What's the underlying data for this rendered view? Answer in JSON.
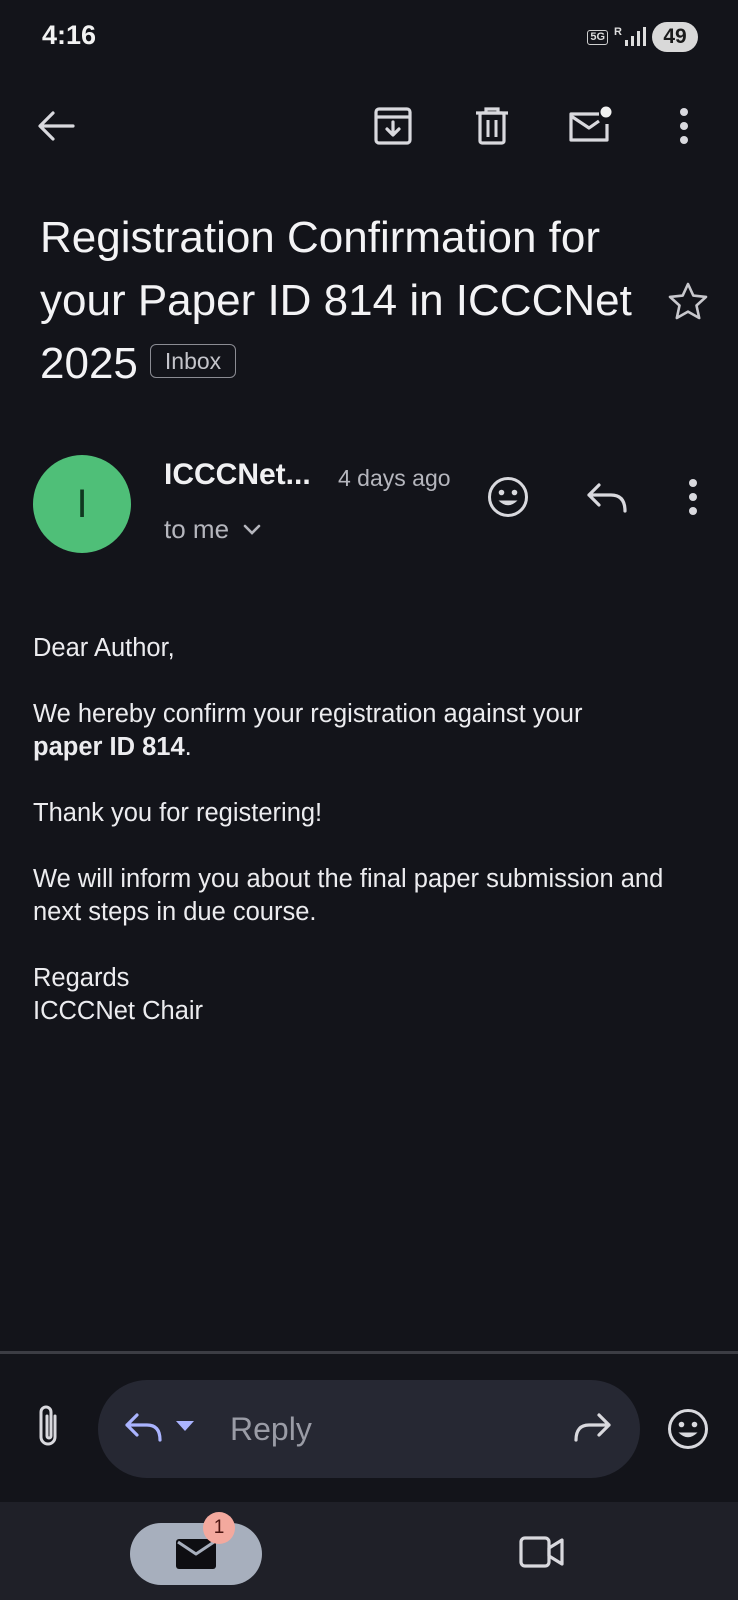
{
  "status_bar": {
    "time": "4:16",
    "network": "5G",
    "signal": "R",
    "battery": "49"
  },
  "toolbar": {
    "icons": [
      "back-arrow-icon",
      "archive-icon",
      "delete-icon",
      "mark-unread-icon",
      "more-vert-icon"
    ]
  },
  "email": {
    "subject_lines": [
      "Registration Confirmation for",
      "your Paper ID 814 in ICCCNet",
      "2025"
    ],
    "label": "Inbox",
    "starred": false,
    "sender": {
      "initial": "I",
      "name": "ICCCNet...",
      "time": "4 days ago",
      "recipient": "to me",
      "avatar_color": "#4fbf78"
    },
    "body": {
      "greeting": "Dear Author,",
      "confirm_text": "We hereby confirm your registration against your",
      "paper_id": "paper ID 814",
      "period": ".",
      "thanks": "Thank you for registering!",
      "inform": "We will inform you about the final paper submission and next steps in due course.",
      "regards": "Regards",
      "signature": "ICCCNet Chair"
    }
  },
  "reply_bar": {
    "reply_label": "Reply"
  },
  "bottom_nav": {
    "mail_badge": "1",
    "items": [
      "mail-icon",
      "video-icon"
    ]
  },
  "colors": {
    "background": "#13141a",
    "avatar": "#4fbf78",
    "badge": "#f3a99e",
    "nav_active": "#a7afbd"
  }
}
